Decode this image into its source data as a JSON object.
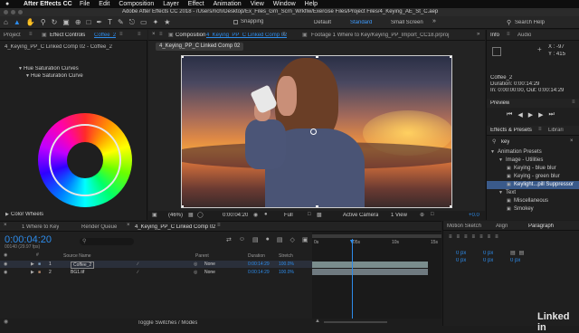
{
  "menubar": {
    "apple": "",
    "app": "After Effects CC",
    "items": [
      "File",
      "Edit",
      "Composition",
      "Layer",
      "Effect",
      "Animation",
      "View",
      "Window",
      "Help"
    ]
  },
  "titlebar": {
    "title": "Adobe After Effects CC 2018 - /Users/rich/Desktop/Ex_Files_Grn_Scrn_Wrkflw/Exercise Files/Project Files/4_Keying_AE_St_C.aep"
  },
  "toolbar": {
    "snapping": "Snapping",
    "workspaces": [
      "Default",
      "Standard",
      "Small Screen"
    ],
    "search_placeholder": "Search Help"
  },
  "left_panel": {
    "tab_project": "Project",
    "tab_effect_prefix": "Effect Controls",
    "tab_effect_layer": "Coffee_2",
    "subtitle": "4_Keying_PP_C Linked Comp 02 - Coffee_2",
    "effect_name": "Hue Saturation Curves",
    "curve_label": "Hue Saturation Curve",
    "color_wheels": "Color Wheels"
  },
  "comp_panel": {
    "tab_prefix": "Composition",
    "tab_name": "4_Keying_PP_C Linked Comp 02",
    "footage_tab": "Footage 1 Where to Key/Keying_PP_Import_CC18.prproj",
    "subtab": "4_Keying_PP_C Linked Comp 02",
    "zoom": "(46%)",
    "timecode": "0:00:04:20",
    "resolution": "Full",
    "camera": "Active Camera",
    "view": "1 View",
    "offset": "+0.0"
  },
  "info_panel": {
    "tab_info": "Info",
    "tab_audio": "Audio",
    "x_label": "X : -97",
    "y_label": "Y : 415",
    "clip_name": "Coffee_2",
    "duration": "Duration: 0:00:14:29",
    "in_out": "In: 0:00:00:00, Out: 0:00:14:29"
  },
  "preview_panel": {
    "title": "Preview"
  },
  "effects_panel": {
    "tab": "Effects & Presets",
    "tab2": "Librari",
    "search": "key",
    "tree": [
      {
        "label": "Animation Presets",
        "level": 0
      },
      {
        "label": "Image - Utilities",
        "level": 1
      },
      {
        "label": "Keying - blue blur",
        "level": 2
      },
      {
        "label": "Keying - green blur",
        "level": 2
      },
      {
        "label": "Keylight...pill Suppressor",
        "level": 2,
        "selected": true
      },
      {
        "label": "Text",
        "level": 1
      },
      {
        "label": "Miscellaneous",
        "level": 2
      },
      {
        "label": "Smokey",
        "level": 2
      }
    ]
  },
  "timeline": {
    "tabs": [
      "1 Where to Key",
      "Render Queue",
      "4_Keying_PP_C Linked Comp 02"
    ],
    "timecode": "0:00:04:20",
    "frame_info": "00140 (29.97 fps)",
    "col_source": "Source Name",
    "col_parent": "Parent",
    "col_duration": "Duration",
    "col_stretch": "Stretch",
    "layers": [
      {
        "num": "1",
        "name": "Coffee_2",
        "parent": "None",
        "duration": "0:00:14:29",
        "stretch": "100.0%"
      },
      {
        "num": "2",
        "name": "BG1.tif",
        "parent": "None",
        "duration": "0:00:14:29",
        "stretch": "100.0%"
      }
    ],
    "ruler": [
      "0s",
      "05s",
      "10s",
      "15s"
    ],
    "playhead_fraction": 0.322,
    "toggle": "Toggle Switches / Modes"
  },
  "right_bottom": {
    "tabs": [
      "Motion Sketch",
      "Align",
      "Paragraph"
    ],
    "px_values": [
      "0 px",
      "0 px",
      "0 px",
      "0 px",
      "0 px"
    ]
  },
  "brand": {
    "logo": "Linked in"
  }
}
